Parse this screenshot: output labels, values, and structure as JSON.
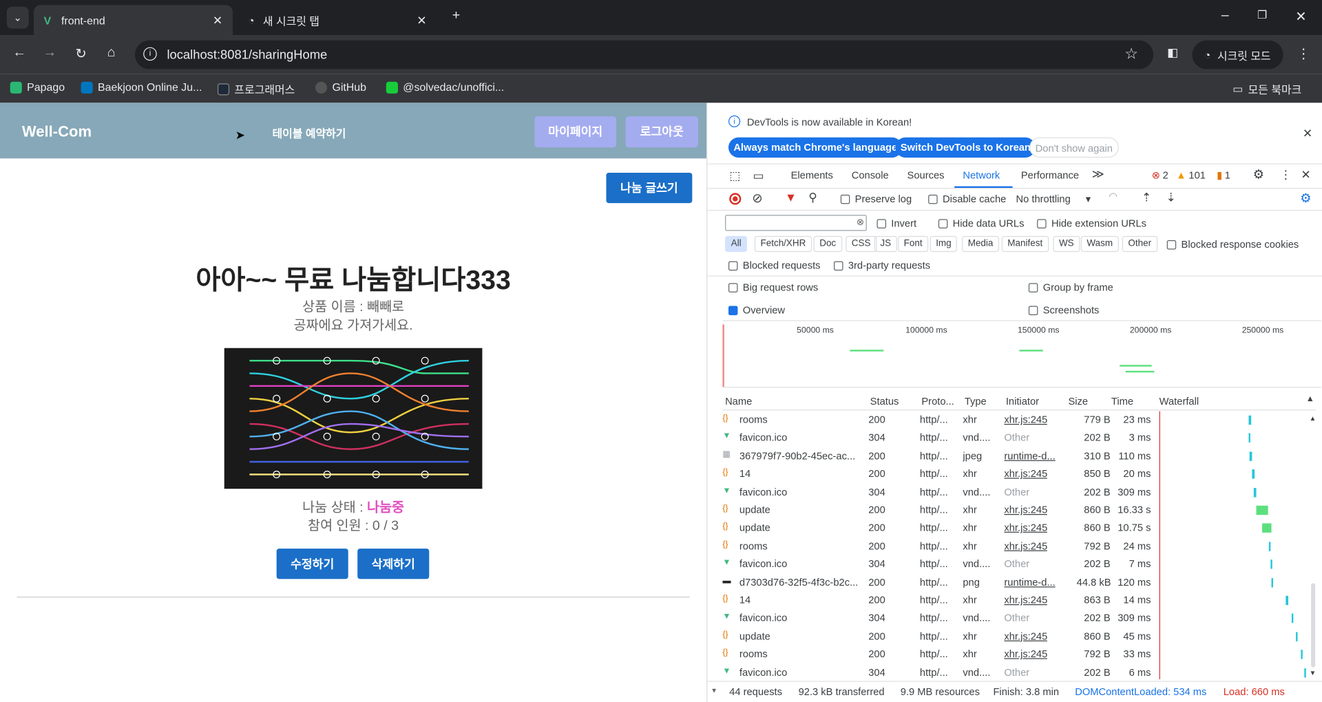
{
  "browser": {
    "tabs": [
      {
        "title": "front-end",
        "active": true
      },
      {
        "title": "새 시크릿 탭",
        "active": false
      }
    ],
    "url": "localhost:8081/sharingHome",
    "profile_label": "시크릿 모드",
    "bookmarks": [
      "Papago",
      "Baekjoon Online Ju...",
      "프로그래머스",
      "GitHub",
      "@solvedac/unoffici..."
    ],
    "all_bookmarks": "모든 북마크"
  },
  "app": {
    "logo": "Well-Com",
    "nav_link": "테이블 예약하기",
    "mypage_button": "마이페이지",
    "logout_button": "로그아웃",
    "write_button": "나눔 글쓰기",
    "post": {
      "title": "아아~~ 무료 나눔합니다333",
      "product_line": "상품 이름 : 빼빼로",
      "description": "공짜에요 가져가세요.",
      "status_label": "나눔 상태 : ",
      "status_value": "나눔중",
      "status_color": "#e050c0",
      "participants": "참여 인원 : 0 / 3"
    },
    "edit_button": "수정하기",
    "delete_button": "삭제하기"
  },
  "devtools": {
    "notice": "DevTools is now available in Korean!",
    "btn_match": "Always match Chrome's language",
    "btn_switch": "Switch DevTools to Korean",
    "btn_dont": "Don't show again",
    "tabs": [
      "Elements",
      "Console",
      "Sources",
      "Network",
      "Performance"
    ],
    "active_tab": "Network",
    "errors": "2",
    "warnings": "101",
    "issues": "1",
    "preserve_log": "Preserve log",
    "disable_cache": "Disable cache",
    "throttling": "No throttling",
    "invert": "Invert",
    "hide_data_urls": "Hide data URLs",
    "hide_ext_urls": "Hide extension URLs",
    "filters": [
      "All",
      "Fetch/XHR",
      "Doc",
      "CSS",
      "JS",
      "Font",
      "Img",
      "Media",
      "Manifest",
      "WS",
      "Wasm",
      "Other"
    ],
    "blocked_cookies": "Blocked response cookies",
    "blocked_requests": "Blocked requests",
    "third_party": "3rd-party requests",
    "big_rows": "Big request rows",
    "group_frame": "Group by frame",
    "overview": "Overview",
    "screenshots": "Screenshots",
    "timeline_ticks": [
      "50000 ms",
      "100000 ms",
      "150000 ms",
      "200000 ms",
      "250000 ms"
    ],
    "columns": [
      "Name",
      "Status",
      "Proto...",
      "Type",
      "Initiator",
      "Size",
      "Time",
      "Waterfall"
    ],
    "rows": [
      {
        "icon": "xhr",
        "name": "rooms",
        "status": "200",
        "proto": "http/...",
        "type": "xhr",
        "initiator": "xhr.js:245",
        "size": "779 B",
        "time": "23 ms"
      },
      {
        "icon": "vue",
        "name": "favicon.ico",
        "status": "304",
        "proto": "http/...",
        "type": "vnd....",
        "initiator": "Other",
        "size": "202 B",
        "time": "3 ms"
      },
      {
        "icon": "img",
        "name": "367979f7-90b2-45ec-ac...",
        "status": "200",
        "proto": "http/...",
        "type": "jpeg",
        "initiator": "runtime-d...",
        "size": "310 B",
        "time": "110 ms"
      },
      {
        "icon": "xhr",
        "name": "14",
        "status": "200",
        "proto": "http/...",
        "type": "xhr",
        "initiator": "xhr.js:245",
        "size": "850 B",
        "time": "20 ms"
      },
      {
        "icon": "vue",
        "name": "favicon.ico",
        "status": "304",
        "proto": "http/...",
        "type": "vnd....",
        "initiator": "Other",
        "size": "202 B",
        "time": "309 ms"
      },
      {
        "icon": "xhr",
        "name": "update",
        "status": "200",
        "proto": "http/...",
        "type": "xhr",
        "initiator": "xhr.js:245",
        "size": "860 B",
        "time": "16.33 s"
      },
      {
        "icon": "xhr",
        "name": "update",
        "status": "200",
        "proto": "http/...",
        "type": "xhr",
        "initiator": "xhr.js:245",
        "size": "860 B",
        "time": "10.75 s"
      },
      {
        "icon": "xhr",
        "name": "rooms",
        "status": "200",
        "proto": "http/...",
        "type": "xhr",
        "initiator": "xhr.js:245",
        "size": "792 B",
        "time": "24 ms"
      },
      {
        "icon": "vue",
        "name": "favicon.ico",
        "status": "304",
        "proto": "http/...",
        "type": "vnd....",
        "initiator": "Other",
        "size": "202 B",
        "time": "7 ms"
      },
      {
        "icon": "png",
        "name": "d7303d76-32f5-4f3c-b2c...",
        "status": "200",
        "proto": "http/...",
        "type": "png",
        "initiator": "runtime-d...",
        "size": "44.8 kB",
        "time": "120 ms"
      },
      {
        "icon": "xhr",
        "name": "14",
        "status": "200",
        "proto": "http/...",
        "type": "xhr",
        "initiator": "xhr.js:245",
        "size": "863 B",
        "time": "14 ms"
      },
      {
        "icon": "vue",
        "name": "favicon.ico",
        "status": "304",
        "proto": "http/...",
        "type": "vnd....",
        "initiator": "Other",
        "size": "202 B",
        "time": "309 ms"
      },
      {
        "icon": "xhr",
        "name": "update",
        "status": "200",
        "proto": "http/...",
        "type": "xhr",
        "initiator": "xhr.js:245",
        "size": "860 B",
        "time": "45 ms"
      },
      {
        "icon": "xhr",
        "name": "rooms",
        "status": "200",
        "proto": "http/...",
        "type": "xhr",
        "initiator": "xhr.js:245",
        "size": "792 B",
        "time": "33 ms"
      },
      {
        "icon": "vue",
        "name": "favicon.ico",
        "status": "304",
        "proto": "http/...",
        "type": "vnd....",
        "initiator": "Other",
        "size": "202 B",
        "time": "6 ms"
      }
    ],
    "summary": {
      "requests": "44 requests",
      "transferred": "92.3 kB transferred",
      "resources": "9.9 MB resources",
      "finish": "Finish: 3.8 min",
      "dcl": "DOMContentLoaded: 534 ms",
      "load": "Load: 660 ms"
    }
  }
}
